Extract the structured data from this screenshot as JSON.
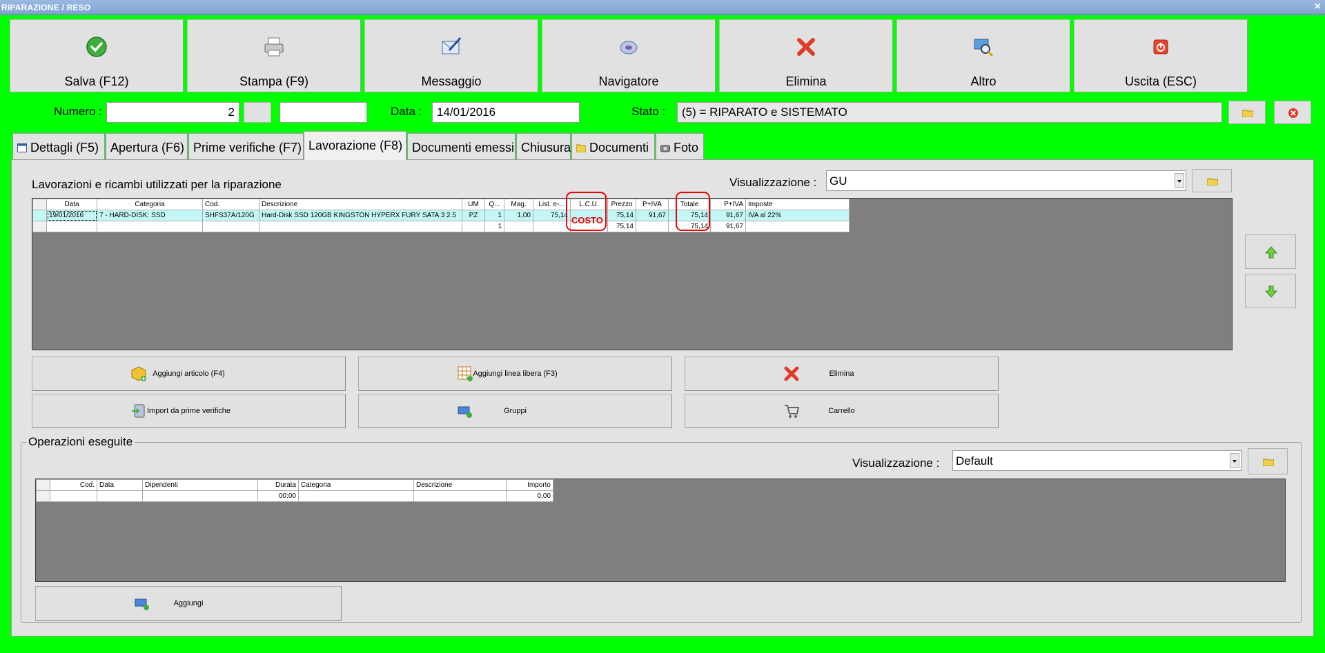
{
  "window": {
    "title": "RIPARAZIONE / RESO",
    "close_glyph": "×"
  },
  "toolbar": [
    {
      "label": "Salva (F12)",
      "icon": "check-icon"
    },
    {
      "label": "Stampa (F9)",
      "icon": "printer-icon"
    },
    {
      "label": "Messaggio",
      "icon": "message-icon"
    },
    {
      "label": "Navigatore",
      "icon": "navigator-icon"
    },
    {
      "label": "Elimina",
      "icon": "delete-icon"
    },
    {
      "label": "Altro",
      "icon": "magnifier-icon"
    },
    {
      "label": "Uscita (ESC)",
      "icon": "exit-icon"
    }
  ],
  "header": {
    "numero_label": "Numero :",
    "numero_value": "2",
    "data_label": "Data :",
    "data_value": "14/01/2016",
    "stato_label": "Stato :",
    "stato_value": "(5) = RIPARATO e SISTEMATO"
  },
  "tabs": [
    {
      "label": "Dettagli (F5)",
      "active": false
    },
    {
      "label": "Apertura (F6)",
      "active": false
    },
    {
      "label": "Prime verifiche (F7)",
      "active": false
    },
    {
      "label": "Lavorazione (F8)",
      "active": true
    },
    {
      "label": "Documenti emessi",
      "active": false
    },
    {
      "label": "Chiusura",
      "active": false
    },
    {
      "label": "Documenti",
      "active": false
    },
    {
      "label": "Foto",
      "active": false
    }
  ],
  "lavorazioni": {
    "title": "Lavorazioni e ricambi utilizzati per la riparazione",
    "view_label": "Visualizzazione :",
    "view_value": "GU",
    "columns": [
      "Data",
      "Categoria",
      "Cod.",
      "Descrizione",
      "UM",
      "Q...",
      "Mag.",
      "List. e-...",
      "L.C.U.",
      "Prezzo",
      "P+IVA",
      "Totale",
      "P+IVA",
      "Imposte"
    ],
    "rows": [
      [
        "19/01/2016",
        "7 - HARD-DISK: SSD",
        "SHFS37A/120G",
        "Hard-Disk SSD 120GB KINGSTON HYPERX FURY SATA 3 2.5",
        "PZ",
        "1",
        "1,00",
        "75,14",
        "",
        "75,14",
        "91,67",
        "75,14",
        "91,67",
        "IVA al 22%"
      ],
      [
        "",
        "",
        "",
        "",
        "",
        "1",
        "",
        "",
        "",
        "75,14",
        "",
        "75,14",
        "91,67",
        ""
      ]
    ],
    "annotation": "COSTO"
  },
  "actions": {
    "aggiungi_articolo": "Aggiungi articolo (F4)",
    "aggiungi_linea": "Aggiungi linea libera (F3)",
    "elimina": "Elimina",
    "import_prime": "Import da prime verifiche",
    "gruppi": "Gruppi",
    "carrello": "Carrello"
  },
  "operazioni": {
    "title": "Operazioni eseguite",
    "view_label": "Visualizzazione :",
    "view_value": "Default",
    "columns": [
      "Cod.",
      "Data",
      "Dipendenti",
      "Durata",
      "Categoria",
      "Descrizione",
      "Importo"
    ],
    "row": [
      "",
      "",
      "",
      "00:00",
      "",
      "",
      "0,00"
    ],
    "aggiungi": "Aggiungi"
  },
  "colors": {
    "background": "#00ff00",
    "selected_row": "#c3f7f7",
    "highlight": "#e00000"
  }
}
